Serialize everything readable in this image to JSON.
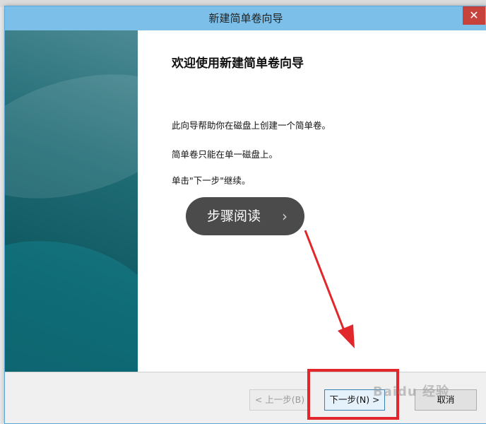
{
  "dialog": {
    "title": "新建简单卷向导",
    "close_label": "✕"
  },
  "content": {
    "heading": "欢迎使用新建简单卷向导",
    "paragraph_1": "此向导帮助你在磁盘上创建一个简单卷。",
    "paragraph_2": "简单卷只能在单一磁盘上。",
    "paragraph_3": "单击\"下一步\"继续。"
  },
  "overlay": {
    "step_pill_label": "步骤阅读",
    "step_pill_chevron": "›",
    "watermark": "Baidu 经验"
  },
  "footer": {
    "back_label": "< 上一步(B)",
    "next_label": "下一步(N) >",
    "cancel_label": "取消"
  },
  "colors": {
    "titlebar": "#7cc0ea",
    "close": "#c7423a",
    "annotation": "#e1262c",
    "side_panel": "#0d5660"
  }
}
